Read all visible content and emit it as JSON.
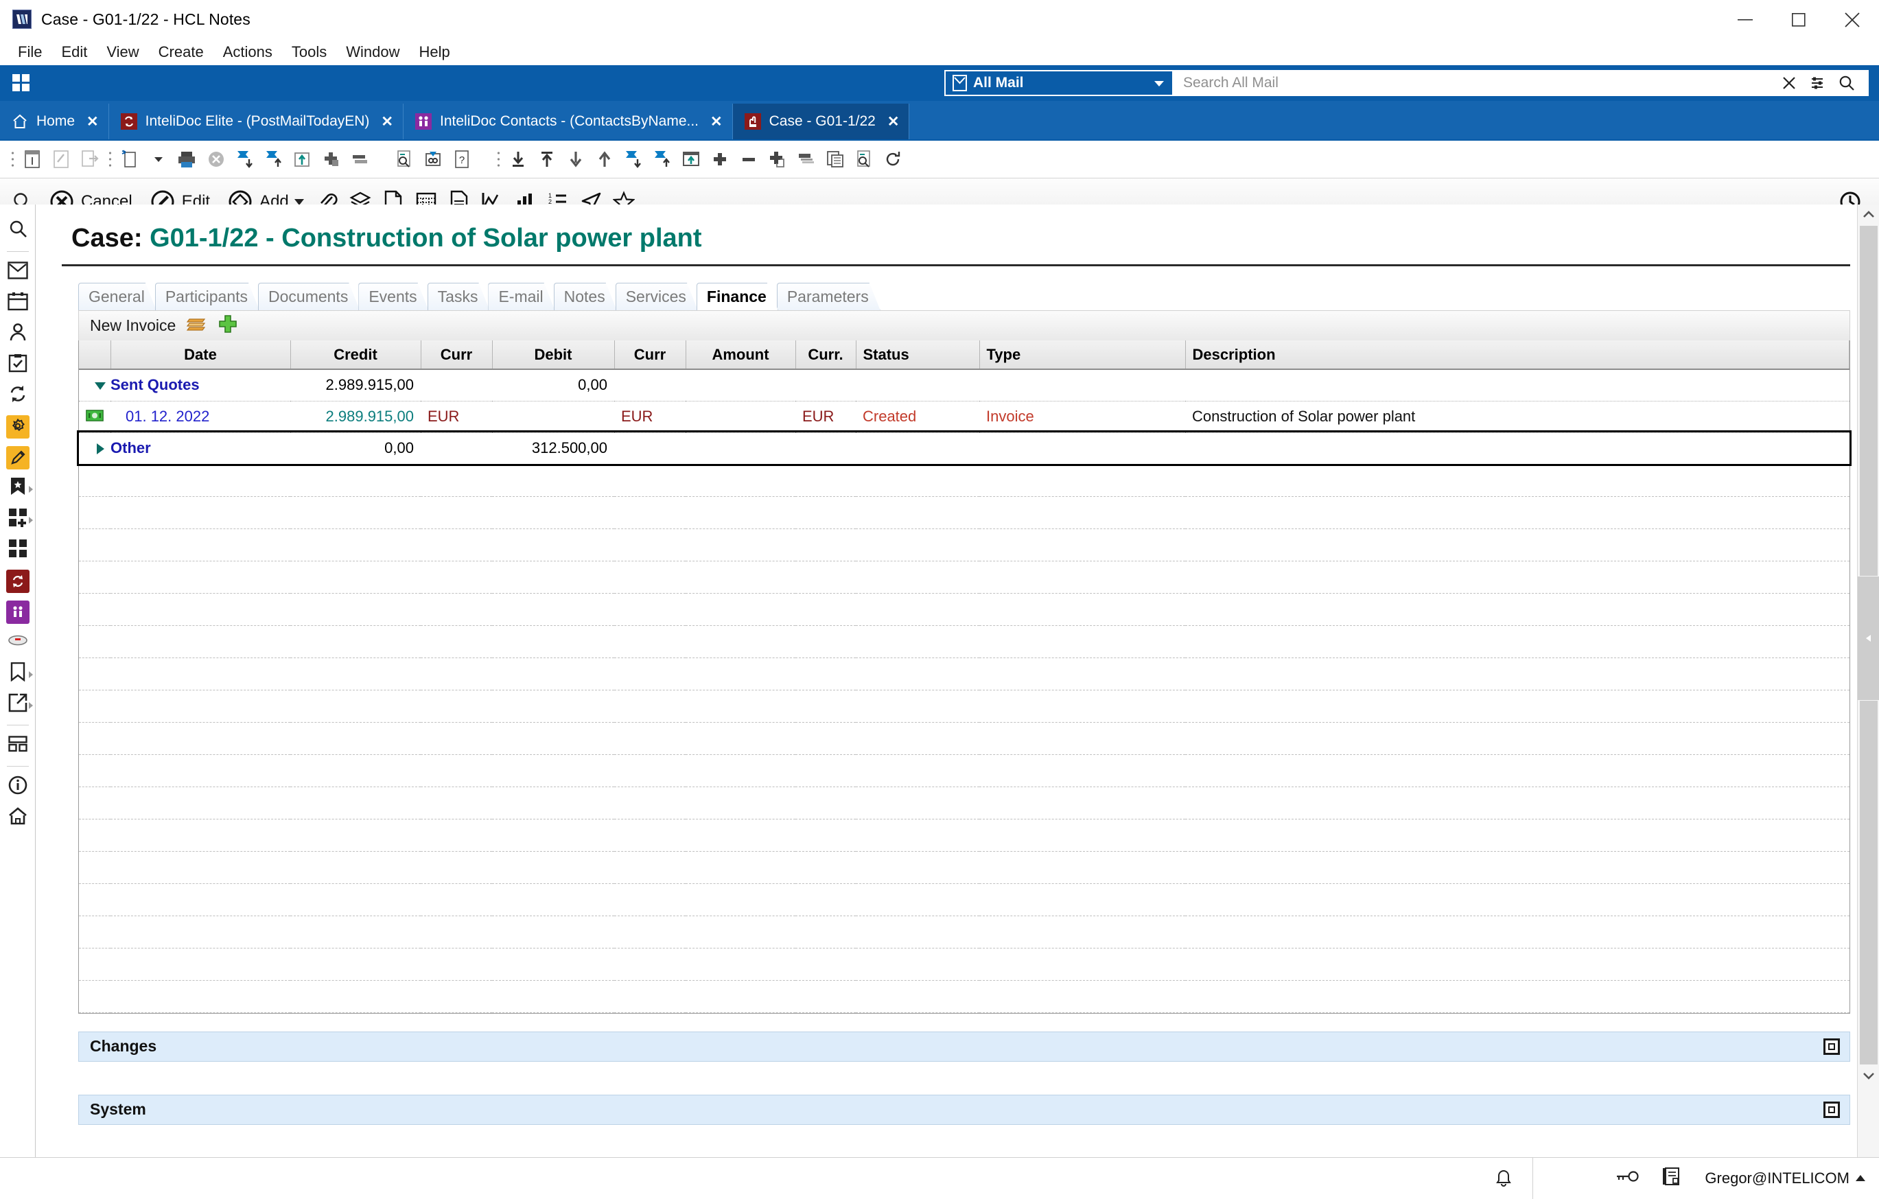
{
  "window": {
    "title": "Case - G01-1/22 - HCL Notes",
    "app_icon": "hcl-notes-icon",
    "minimize": "minimize-icon",
    "maximize": "maximize-icon",
    "close": "close-icon"
  },
  "menubar": {
    "items": [
      {
        "label": "File"
      },
      {
        "label": "Edit"
      },
      {
        "label": "View"
      },
      {
        "label": "Create"
      },
      {
        "label": "Actions"
      },
      {
        "label": "Tools"
      },
      {
        "label": "Window"
      },
      {
        "label": "Help"
      }
    ]
  },
  "bluebar": {
    "waffle": "apps-grid-icon",
    "mailbox_label": "All Mail",
    "search_placeholder": "Search All Mail",
    "search_value": "",
    "clear_icon": "close-x-icon",
    "filter_icon": "search-options-icon",
    "search_icon": "search-icon"
  },
  "tabs": [
    {
      "label": "Home",
      "icon": "home-icon",
      "active": false,
      "close": "✕"
    },
    {
      "label": "InteliDoc Elite - (PostMailTodayEN)",
      "icon": "intelidoc-elite-icon",
      "active": false,
      "close": "✕"
    },
    {
      "label": "InteliDoc Contacts - (ContactsByName...",
      "icon": "intelidoc-contacts-icon",
      "active": false,
      "close": "✕"
    },
    {
      "label": "Case - G01-1/22",
      "icon": "case-icon",
      "active": true,
      "close": "✕"
    }
  ],
  "toolbar1": {
    "icons": [
      "properties-icon",
      "edit-document-icon",
      "forward-document-icon",
      "new-document-icon",
      "new-document-dropdown-icon",
      "print-icon",
      "delete-icon",
      "move-down-icon",
      "move-up-icon",
      "folder-move-icon",
      "add-category-icon",
      "collapse-icon",
      "find-icon",
      "link-icon",
      "help-document-icon",
      "import-icon",
      "export-top-icon",
      "move-down-arrow-icon",
      "move-up-arrow-icon",
      "send-down-icon",
      "send-up-icon",
      "open-in-window-icon",
      "add-icon",
      "remove-icon",
      "duplicate-icon",
      "stack-icon",
      "copy-table-icon",
      "preview-icon",
      "refresh-icon"
    ]
  },
  "actionbar": {
    "search_icon": "search-icon",
    "cancel_label": "Cancel",
    "edit_label": "Edit",
    "add_label": "Add",
    "icons": [
      "attachment-icon",
      "layers-icon",
      "page-icon",
      "table-icon",
      "document-icon",
      "line-chart-icon",
      "bar-chart-icon",
      "list-icon",
      "send-icon",
      "star-icon"
    ],
    "history_icon": "clock-icon"
  },
  "sidebar": {
    "items": [
      {
        "name": "search",
        "icon": "search-icon"
      },
      {
        "name": "mail",
        "icon": "envelope-icon"
      },
      {
        "name": "calendar",
        "icon": "calendar-icon"
      },
      {
        "name": "contacts",
        "icon": "person-icon"
      },
      {
        "name": "todo",
        "icon": "clipboard-check-icon"
      },
      {
        "name": "replication",
        "icon": "sync-icon"
      },
      {
        "name": "settings",
        "icon": "gear-icon",
        "color": "#f5b324"
      },
      {
        "name": "notes-editor",
        "icon": "pencil-icon",
        "color": "#f5b324"
      },
      {
        "name": "bookmarks-star",
        "icon": "bookmark-star-icon",
        "arrow": true
      },
      {
        "name": "add-app",
        "icon": "apps-add-icon",
        "arrow": true
      },
      {
        "name": "applications",
        "icon": "apps-grid-icon"
      },
      {
        "name": "intelidoc-elite",
        "icon": "intelidoc-elite-icon",
        "color": "#8c1a1a"
      },
      {
        "name": "intelidoc-contacts",
        "icon": "intelidoc-contacts-icon",
        "color": "#8a2aa0"
      },
      {
        "name": "database",
        "icon": "database-icon"
      },
      {
        "name": "bookmark",
        "icon": "bookmark-icon",
        "arrow": true
      },
      {
        "name": "open-external",
        "icon": "open-external-icon",
        "arrow": true
      },
      {
        "name": "widgets",
        "icon": "widgets-icon"
      },
      {
        "name": "info",
        "icon": "info-icon"
      },
      {
        "name": "home",
        "icon": "home-icon"
      }
    ]
  },
  "document": {
    "title_prefix": "Case:",
    "title_code": "G01-1/22 - Construction of Solar power plant",
    "form_tabs": [
      {
        "label": "General",
        "active": false
      },
      {
        "label": "Participants",
        "active": false
      },
      {
        "label": "Documents",
        "active": false
      },
      {
        "label": "Events",
        "active": false
      },
      {
        "label": "Tasks",
        "active": false
      },
      {
        "label": "E-mail",
        "active": false
      },
      {
        "label": "Notes",
        "active": false
      },
      {
        "label": "Services",
        "active": false
      },
      {
        "label": "Finance",
        "active": true
      },
      {
        "label": "Parameters",
        "active": false
      }
    ]
  },
  "finance": {
    "toolbar": {
      "new_invoice_label": "New Invoice",
      "stack_icon": "orange-stack-icon",
      "add_icon": "green-plus-icon"
    },
    "columns": [
      {
        "key": "icon",
        "label": ""
      },
      {
        "key": "date",
        "label": "Date"
      },
      {
        "key": "credit",
        "label": "Credit"
      },
      {
        "key": "curr1",
        "label": "Curr"
      },
      {
        "key": "debit",
        "label": "Debit"
      },
      {
        "key": "curr2",
        "label": "Curr"
      },
      {
        "key": "amount",
        "label": "Amount"
      },
      {
        "key": "curr3",
        "label": "Curr."
      },
      {
        "key": "status",
        "label": "Status"
      },
      {
        "key": "type",
        "label": "Type"
      },
      {
        "key": "description",
        "label": "Description"
      }
    ],
    "rows": [
      {
        "kind": "category",
        "expanded": true,
        "label": "Sent Quotes",
        "credit": "2.989.915,00",
        "curr1": "",
        "debit": "0,00",
        "curr2": "",
        "amount": "",
        "curr3": "",
        "status": "",
        "type": "",
        "description": ""
      },
      {
        "kind": "document",
        "icon": "money-icon",
        "date": "01. 12. 2022",
        "credit": "2.989.915,00",
        "curr1": "EUR",
        "debit": "",
        "curr2": "EUR",
        "amount": "",
        "curr3": "EUR",
        "status": "Created",
        "type": "Invoice",
        "description": "Construction of Solar power plant"
      },
      {
        "kind": "category",
        "expanded": false,
        "selected": true,
        "label": "Other",
        "credit": "0,00",
        "curr1": "",
        "debit": "312.500,00",
        "curr2": "",
        "amount": "",
        "curr3": "",
        "status": "",
        "type": "",
        "description": ""
      }
    ],
    "empty_row_count": 18
  },
  "sections": [
    {
      "label": "Changes",
      "toggle": "restore-box-icon"
    },
    {
      "label": "System",
      "toggle": "restore-box-icon"
    }
  ],
  "statusbar": {
    "bell_icon": "notification-bell-icon",
    "key_icon": "key-icon",
    "cert_icon": "certificate-icon",
    "user": "Gregor@INTELICOM",
    "user_caret": "caret-up-icon"
  },
  "colors": {
    "brand_blue": "#0a5ca8",
    "tab_blue": "#1565b0",
    "accent_teal": "#00796b",
    "link_blue": "#2222cc",
    "status_red": "#c23a2a",
    "section_blue": "#ddecfa"
  }
}
